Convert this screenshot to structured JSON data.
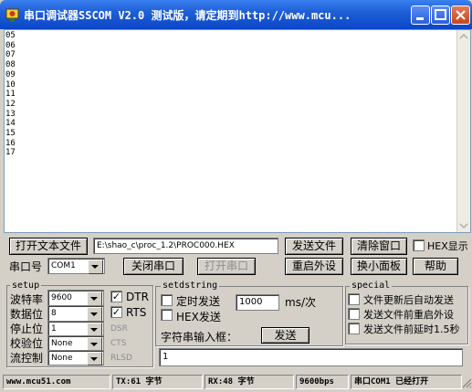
{
  "window": {
    "title": "串口调试器SSCOM V2.0  测试版，请定期到http://www.mcu..."
  },
  "receive": {
    "text": "05\n06\n07\n08\n09\n10\n11\n12\n13\n14\n15\n16\n17"
  },
  "toolbar": {
    "open_file_label": "打开文本文件",
    "file_path": "E:\\shao_c\\proc_1.2\\PROC000.HEX",
    "send_file_label": "发送文件",
    "clear_label": "清除窗口",
    "hex_show_label": "HEX显示",
    "port_label": "串口号",
    "port_value": "COM1",
    "close_port_label": "关闭串口",
    "open_port_label": "打开串口",
    "restart_label": "重启外设",
    "switch_panel_label": "换小面板",
    "help_label": "帮助"
  },
  "setup": {
    "title": "setup",
    "baud_label": "波特率",
    "baud_value": "9600",
    "data_label": "数据位",
    "data_value": "8",
    "stop_label": "停止位",
    "stop_value": "1",
    "parity_label": "校验位",
    "parity_value": "None",
    "flow_label": "流控制",
    "flow_value": "None",
    "dtr_label": "DTR",
    "rts_label": "RTS",
    "dsr_label": "DSR",
    "cts_label": "CTS",
    "rlsd_label": "RLSD",
    "dtr_checked": "✓",
    "rts_checked": "✓"
  },
  "setdstring": {
    "title": "setdstring",
    "timer_label": "定时发送",
    "interval_value": "1000",
    "unit_label": "ms/次",
    "hex_send_label": "HEX发送",
    "input_label": "字符串输入框：",
    "send_label": "发送",
    "input_value": "1"
  },
  "special": {
    "title": "special",
    "opt1": "文件更新后自动发送",
    "opt2": "发送文件前重启外设",
    "opt3": "发送文件前延时1.5秒"
  },
  "status": {
    "site": "www.mcu51.com",
    "tx": "TX:61 字节",
    "rx": "RX:48 字节",
    "baud": "9600bps",
    "port_state": "串口COM1 已经打开"
  }
}
